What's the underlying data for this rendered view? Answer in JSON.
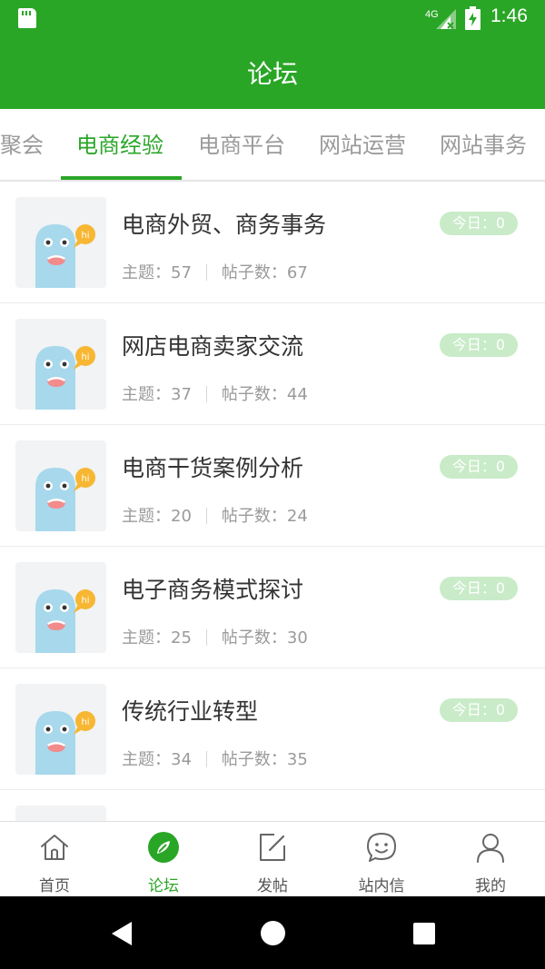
{
  "status_bar": {
    "time": "1:46",
    "network": "4G",
    "icons": [
      "sd-card-icon",
      "signal-icon",
      "battery-icon"
    ]
  },
  "app_bar": {
    "title": "论坛"
  },
  "tabs": [
    {
      "label": "聚会",
      "active": false
    },
    {
      "label": "电商经验",
      "active": true
    },
    {
      "label": "电商平台",
      "active": false
    },
    {
      "label": "网站运营",
      "active": false
    },
    {
      "label": "网站事务",
      "active": false
    }
  ],
  "forums": [
    {
      "title": "电商外贸、商务事务",
      "topics_label": "主题：",
      "topics": "57",
      "posts_label": "帖子数：",
      "posts": "67",
      "today": "今日：0"
    },
    {
      "title": "网店电商卖家交流",
      "topics_label": "主题：",
      "topics": "37",
      "posts_label": "帖子数：",
      "posts": "44",
      "today": "今日：0"
    },
    {
      "title": "电商干货案例分析",
      "topics_label": "主题：",
      "topics": "20",
      "posts_label": "帖子数：",
      "posts": "24",
      "today": "今日：0"
    },
    {
      "title": "电子商务模式探讨",
      "topics_label": "主题：",
      "topics": "25",
      "posts_label": "帖子数：",
      "posts": "30",
      "today": "今日：0"
    },
    {
      "title": "传统行业转型",
      "topics_label": "主题：",
      "topics": "34",
      "posts_label": "帖子数：",
      "posts": "35",
      "today": "今日：0"
    }
  ],
  "bottom_nav": [
    {
      "label": "首页",
      "icon": "home-icon",
      "active": false
    },
    {
      "label": "论坛",
      "icon": "compass-icon",
      "active": true
    },
    {
      "label": "发帖",
      "icon": "compose-icon",
      "active": false
    },
    {
      "label": "站内信",
      "icon": "chat-smile-icon",
      "active": false
    },
    {
      "label": "我的",
      "icon": "profile-icon",
      "active": false
    }
  ],
  "colors": {
    "primary": "#2aa627",
    "badge_bg": "#c9ebc8",
    "muted_text": "#9a9a9a",
    "title_text": "#333333"
  }
}
